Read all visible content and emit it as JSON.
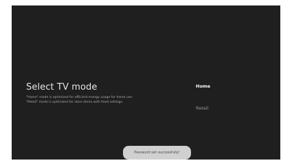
{
  "page": {
    "title": "Select TV mode",
    "description_lines": [
      "\"Home\" mode is optimized for efficient energy usage for home use.",
      "\"Retail\" mode is optimized for store demo with fixed settings."
    ]
  },
  "options": [
    {
      "label": "Home",
      "selected": true
    },
    {
      "label": "Retail",
      "selected": false
    }
  ],
  "toast": {
    "message": "Password set successfully!"
  },
  "colors": {
    "background": "#1f1f1f",
    "title": "#e6e6e6",
    "selected_option": "#ffffff",
    "unselected_option": "#9a9a9a",
    "toast_bg": "#d0d0d0"
  }
}
